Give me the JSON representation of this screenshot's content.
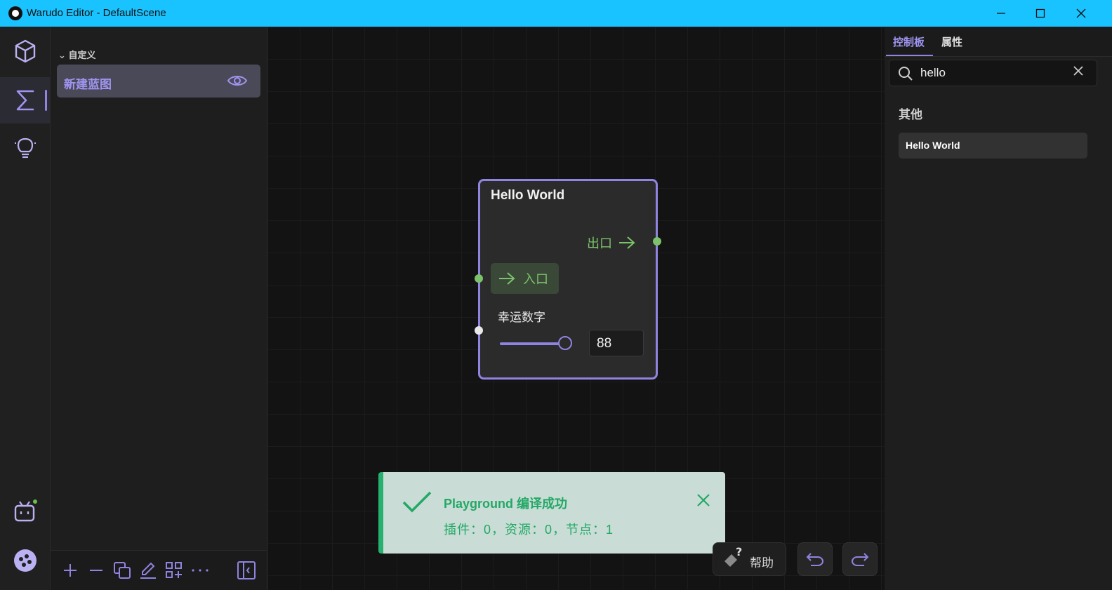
{
  "window": {
    "title": "Warudo Editor - DefaultScene",
    "controls": [
      "minimize-icon",
      "maximize-icon",
      "close-icon"
    ]
  },
  "rail": {
    "items": [
      "cube-icon",
      "sigma-icon",
      "lightbulb-icon",
      "bilibili-tv-icon",
      "warudo-logo-icon"
    ],
    "active": "sigma-icon",
    "status_dot_color": "#6cc04a"
  },
  "blueprint_panel": {
    "group_label": "自定义",
    "items": [
      {
        "label": "新建蓝图",
        "icon": "eye-icon"
      }
    ],
    "toolbar": [
      "plus-icon",
      "minus-icon",
      "duplicate-icon",
      "edit-icon",
      "add-grid-icon",
      "more-icon",
      "collapse-panel-icon"
    ]
  },
  "node": {
    "title": "Hello World",
    "exit_label": "出口",
    "entry_label": "入口",
    "param_label": "幸运数字",
    "param_value": "88",
    "accent": "#8f84e0",
    "flow_color": "#7cc26a"
  },
  "toast": {
    "title": "Playground 编译成功",
    "message": "插件：0，资源：0，节点：1",
    "color": "#24a866",
    "background": "#c9ddd6"
  },
  "bottom": {
    "help_label": "帮助",
    "undo_icon": "undo-icon",
    "redo_icon": "redo-icon"
  },
  "right_panel": {
    "tabs": [
      {
        "label": "控制板",
        "active": true
      },
      {
        "label": "属性",
        "active": false
      }
    ],
    "search": {
      "value": "hello"
    },
    "category": "其他",
    "results": [
      {
        "label": "Hello World"
      }
    ]
  }
}
